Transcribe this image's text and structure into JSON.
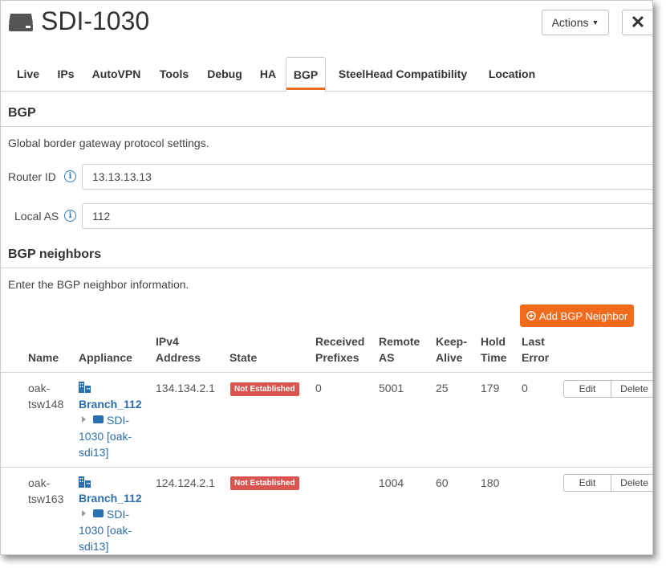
{
  "header": {
    "title": "SDI-1030",
    "actions_label": "Actions",
    "close_label": "✕"
  },
  "tabs": [
    {
      "label": "Live"
    },
    {
      "label": "IPs"
    },
    {
      "label": "AutoVPN"
    },
    {
      "label": "Tools"
    },
    {
      "label": "Debug"
    },
    {
      "label": "HA"
    },
    {
      "label": "BGP",
      "active": true
    },
    {
      "label": "SteelHead Compatibility"
    },
    {
      "label": "Location"
    }
  ],
  "bgp": {
    "title": "BGP",
    "description": "Global border gateway protocol settings.",
    "router_id_label": "Router ID",
    "router_id_value": "13.13.13.13",
    "local_as_label": "Local AS",
    "local_as_value": "112"
  },
  "neighbors": {
    "title": "BGP neighbors",
    "description": "Enter the BGP neighbor information.",
    "add_button_label": "Add BGP Neighbor",
    "columns": {
      "name": "Name",
      "appliance": "Appliance",
      "ipv4_line1": "IPv4",
      "ipv4_line2": "Address",
      "state": "State",
      "received_line1": "Received",
      "received_line2": "Prefixes",
      "remote_line1": "Remote",
      "remote_line2": "AS",
      "keep_line1": "Keep-",
      "keep_line2": "Alive",
      "hold_line1": "Hold",
      "hold_line2": "Time",
      "last_line1": "Last",
      "last_line2": "Error"
    },
    "rows": [
      {
        "name_line1": "oak-",
        "name_line2": "tsw148",
        "site": "Branch_112",
        "appliance_line1": "SDI-",
        "appliance_line2": "1030 [oak-",
        "appliance_line3": "sdi13]",
        "ipv4": "134.134.2.1",
        "state": "Not Established",
        "received_prefixes": "0",
        "remote_as": "5001",
        "keep_alive": "25",
        "hold_time": "179",
        "last_error": "0",
        "edit_label": "Edit",
        "delete_label": "Delete"
      },
      {
        "name_line1": "oak-",
        "name_line2": "tsw163",
        "site": "Branch_112",
        "appliance_line1": "SDI-",
        "appliance_line2": "1030 [oak-",
        "appliance_line3": "sdi13]",
        "ipv4": "124.124.2.1",
        "state": "Not Established",
        "received_prefixes": "",
        "remote_as": "1004",
        "keep_alive": "60",
        "hold_time": "180",
        "last_error": "",
        "edit_label": "Edit",
        "delete_label": "Delete"
      }
    ]
  },
  "colors": {
    "accent": "#f26a1b",
    "link": "#2b6fb0",
    "badge": "#d9534f"
  }
}
